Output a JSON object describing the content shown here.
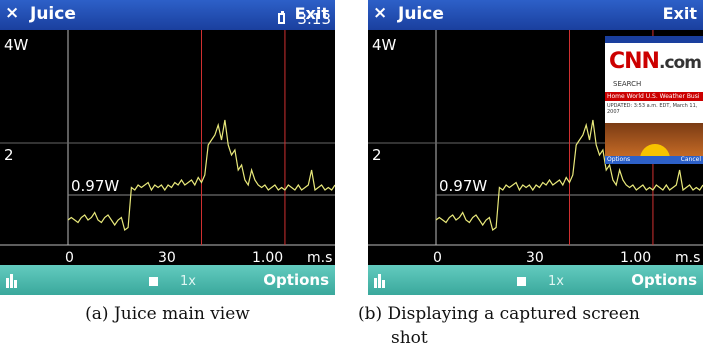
{
  "app": {
    "title": "Juice",
    "close_glyph": "×",
    "exit_label": "Exit"
  },
  "axis": {
    "y_ticks": [
      "4W",
      "2"
    ],
    "x_ticks": [
      "0",
      "30",
      "1.00",
      "m.s"
    ],
    "marker_label": "0.97W"
  },
  "status": {
    "clock": "3:13"
  },
  "toolbar": {
    "speed": "1x",
    "options_label": "Options"
  },
  "panels": [
    {
      "caption_line1": "(a) Juice main view",
      "caption_line2": ""
    },
    {
      "caption_line1": "(b) Displaying a captured screen",
      "caption_line2": "shot"
    }
  ],
  "thumbnail": {
    "logo_main": "CNN",
    "logo_suffix": ".com",
    "search_label": "SEARCH",
    "nav_text": "Home World U.S. Weather Busi",
    "news_text": "UPDATED: 3:53 a.m. EDT, March 11, 2007",
    "footer_left": "Options",
    "footer_right": "Cancel"
  },
  "colors": {
    "title_blue": "#1a3f9e",
    "toolbar_teal": "#4cb8ab",
    "trace": "#e8e87a",
    "marker_line": "#d03030"
  },
  "chart_data": {
    "type": "line",
    "xlabel": "m.s",
    "ylabel": "",
    "ylim": [
      0,
      4
    ],
    "xlim": [
      0,
      80
    ],
    "reference_level": 0.97,
    "series": [
      {
        "x": [
          0,
          1,
          2,
          3,
          4,
          5,
          6,
          7,
          8,
          9,
          10,
          11,
          12,
          13,
          14,
          15,
          16,
          17,
          18,
          19,
          20,
          21,
          22,
          23,
          24,
          25,
          26,
          27,
          28,
          29,
          30,
          31,
          32,
          33,
          34,
          35,
          36,
          37,
          38,
          39,
          40,
          41,
          42,
          43,
          44,
          45,
          46,
          47,
          48,
          49,
          50,
          51,
          52,
          53,
          54,
          55,
          56,
          57,
          58,
          59,
          60,
          61,
          62,
          63,
          64,
          65,
          66,
          67,
          68,
          69,
          70,
          71,
          72,
          73,
          74,
          75,
          76,
          77,
          78,
          79,
          80
        ],
        "y": [
          0.5,
          0.55,
          0.5,
          0.45,
          0.55,
          0.6,
          0.5,
          0.55,
          0.65,
          0.5,
          0.45,
          0.55,
          0.6,
          0.5,
          0.4,
          0.5,
          0.55,
          0.3,
          0.35,
          1.15,
          1.1,
          1.2,
          1.15,
          1.2,
          1.25,
          1.1,
          1.2,
          1.15,
          1.2,
          1.1,
          1.2,
          1.15,
          1.25,
          1.2,
          1.3,
          1.2,
          1.25,
          1.3,
          1.2,
          1.35,
          1.25,
          1.4,
          2.0,
          2.1,
          2.2,
          2.4,
          2.1,
          2.5,
          2.0,
          1.8,
          1.9,
          1.5,
          1.6,
          1.3,
          1.2,
          1.5,
          1.3,
          1.2,
          1.15,
          1.2,
          1.1,
          1.15,
          1.2,
          1.1,
          1.15,
          1.1,
          1.2,
          1.15,
          1.1,
          1.2,
          1.1,
          1.15,
          1.2,
          1.5,
          1.1,
          1.15,
          1.2,
          1.1,
          1.15,
          1.1,
          1.2
        ]
      }
    ],
    "vertical_markers": [
      40,
      65
    ]
  }
}
